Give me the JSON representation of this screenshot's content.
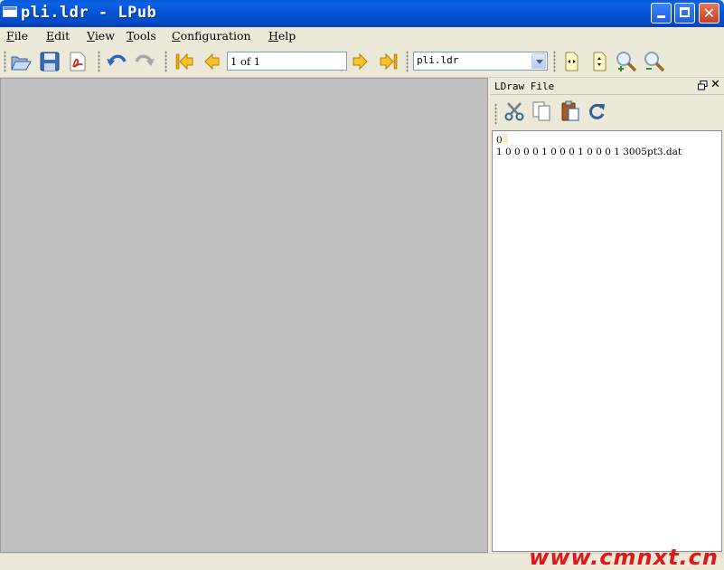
{
  "window": {
    "title": "pli.ldr - LPub",
    "controls": {
      "close_glyph": "✕"
    }
  },
  "menu": [
    "File",
    "Edit",
    "View",
    "Tools",
    "Configuration",
    "Help"
  ],
  "toolbar": {
    "icons": [
      "open-folder-icon",
      "save-disk-icon",
      "pdf-export-icon",
      "undo-icon",
      "redo-icon",
      "first-page-icon",
      "previous-page-icon",
      "next-page-icon",
      "last-page-icon",
      "fit-width-icon",
      "fit-page-icon",
      "zoom-in-icon",
      "zoom-out-icon"
    ],
    "page_field_value": "1 of 1",
    "file_select_value": "pli.ldr"
  },
  "dock": {
    "title": "LDraw File",
    "float_glyph": "🗗",
    "close_glyph": "✕",
    "toolbar_icons": [
      "cut-icon",
      "copy-icon",
      "paste-icon",
      "refresh-icon"
    ],
    "lines": [
      "0",
      "1 0 0 0 0 1 0 0 0 1 0 0 0 1 3005pt3.dat"
    ]
  },
  "watermark": "www.cmnxt.cn",
  "colors": {
    "titlebar": "#0553d0",
    "canvas_bg": "#c0c0c0",
    "window_bg": "#ece9d8",
    "watermark": "#e01818"
  }
}
